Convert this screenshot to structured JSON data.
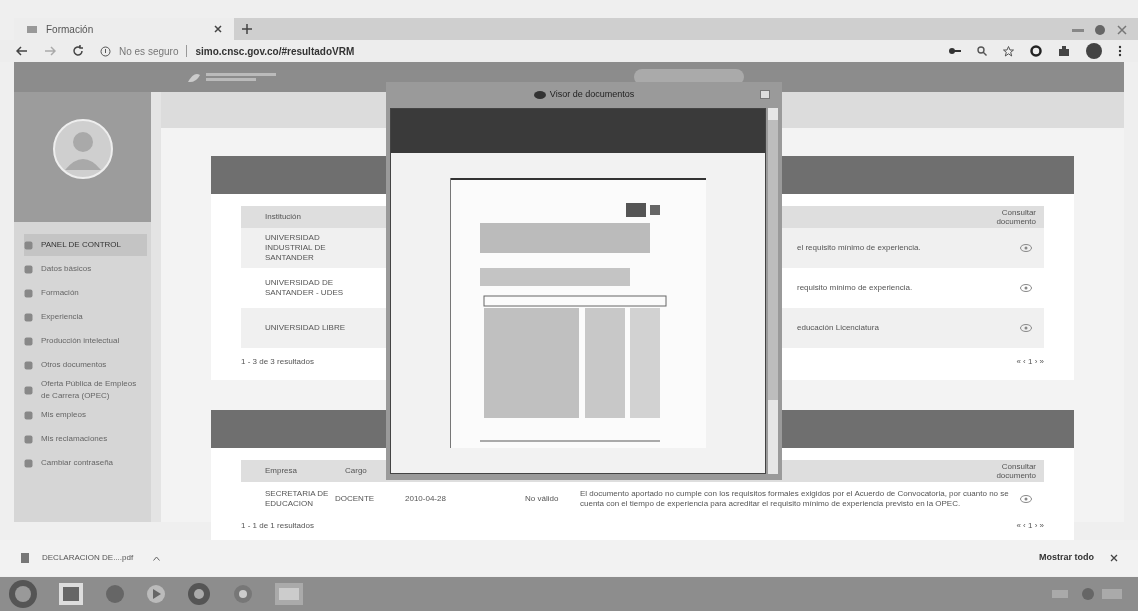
{
  "browser": {
    "tab_title": "Formación",
    "security": "No es seguro",
    "url": "simo.cnsc.gov.co/#resultadoVRM"
  },
  "sidebar": {
    "items": [
      {
        "label": "PANEL DE CONTROL",
        "selected": true
      },
      {
        "label": "Datos básicos",
        "selected": false
      },
      {
        "label": "Formación",
        "selected": false
      },
      {
        "label": "Experiencia",
        "selected": false
      },
      {
        "label": "Producción intelectual",
        "selected": false
      },
      {
        "label": "Otros documentos",
        "selected": false
      },
      {
        "label": "Oferta Pública de Empleos de Carrera (OPEC)",
        "selected": false
      },
      {
        "label": "Mis empleos",
        "selected": false
      },
      {
        "label": "Mis reclamaciones",
        "selected": false
      },
      {
        "label": "Cambiar contraseña",
        "selected": false
      }
    ]
  },
  "education_table": {
    "columns": [
      "Institución",
      "Consultar documento"
    ],
    "rows": [
      {
        "institution": "UNIVERSIDAD INDUSTRIAL DE SANTANDER",
        "note": "el requisito mínimo de experiencia."
      },
      {
        "institution": "UNIVERSIDAD DE SANTANDER - UDES",
        "note": "requisito mínimo de experiencia."
      },
      {
        "institution": "UNIVERSIDAD LIBRE",
        "note": "educación Licenciatura"
      }
    ],
    "footer": "1 - 3 de 3 resultados",
    "pager": "« ‹ 1 › »"
  },
  "experience_table": {
    "columns": [
      "Empresa",
      "Cargo",
      "Consultar documento"
    ],
    "rows": [
      {
        "company": "SECRETARIA DE EDUCACION",
        "position": "DOCENTE",
        "date": "2010-04-28",
        "status": "No válido",
        "note": "El documento aportado no cumple con los requisitos formales exigidos por el Acuerdo de Convocatoria, por cuanto no se cuenta con el tiempo de experiencia para acreditar el requisito mínimo de experiencia previsto en la OPEC."
      }
    ],
    "footer": "1 - 1 de 1 resultados",
    "pager": "« ‹ 1 › »"
  },
  "modal": {
    "title": "Visor de documentos"
  },
  "download_bar": {
    "file": "DECLARACION DE....pdf",
    "show_all": "Mostrar todo"
  }
}
